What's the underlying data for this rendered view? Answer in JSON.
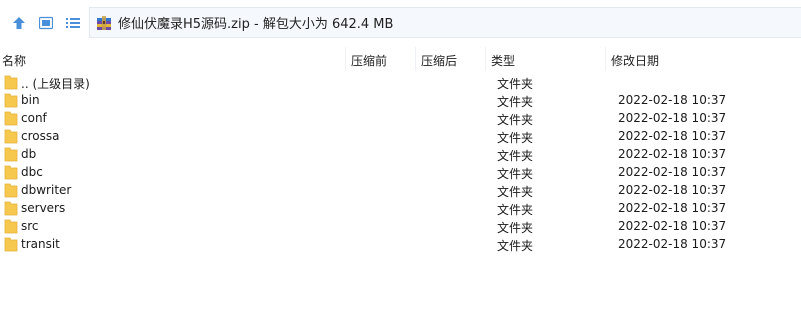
{
  "toolbar": {
    "up_icon": "arrow-up-icon",
    "view_icon": "view-mode-icon",
    "list_icon": "list-view-icon"
  },
  "path": {
    "icon": "winrar-archive-icon",
    "text": "修仙伏魔录H5源码.zip - 解包大小为 642.4 MB"
  },
  "columns": {
    "name": "名称",
    "compressed": "压缩前",
    "after": "压缩后",
    "type": "类型",
    "modified": "修改日期"
  },
  "rows": [
    {
      "name": ".. (上级目录)",
      "type": "文件夹",
      "date": ""
    },
    {
      "name": "bin",
      "type": "文件夹",
      "date": "2022-02-18 10:37"
    },
    {
      "name": "conf",
      "type": "文件夹",
      "date": "2022-02-18 10:37"
    },
    {
      "name": "crossa",
      "type": "文件夹",
      "date": "2022-02-18 10:37"
    },
    {
      "name": "db",
      "type": "文件夹",
      "date": "2022-02-18 10:37"
    },
    {
      "name": "dbc",
      "type": "文件夹",
      "date": "2022-02-18 10:37"
    },
    {
      "name": "dbwriter",
      "type": "文件夹",
      "date": "2022-02-18 10:37"
    },
    {
      "name": "servers",
      "type": "文件夹",
      "date": "2022-02-18 10:37"
    },
    {
      "name": "src",
      "type": "文件夹",
      "date": "2022-02-18 10:37"
    },
    {
      "name": "transit",
      "type": "文件夹",
      "date": "2022-02-18 10:37"
    }
  ],
  "colors": {
    "folder": "#f6c94e",
    "folder_dark": "#e5b33a",
    "accent": "#4a8fd9"
  }
}
